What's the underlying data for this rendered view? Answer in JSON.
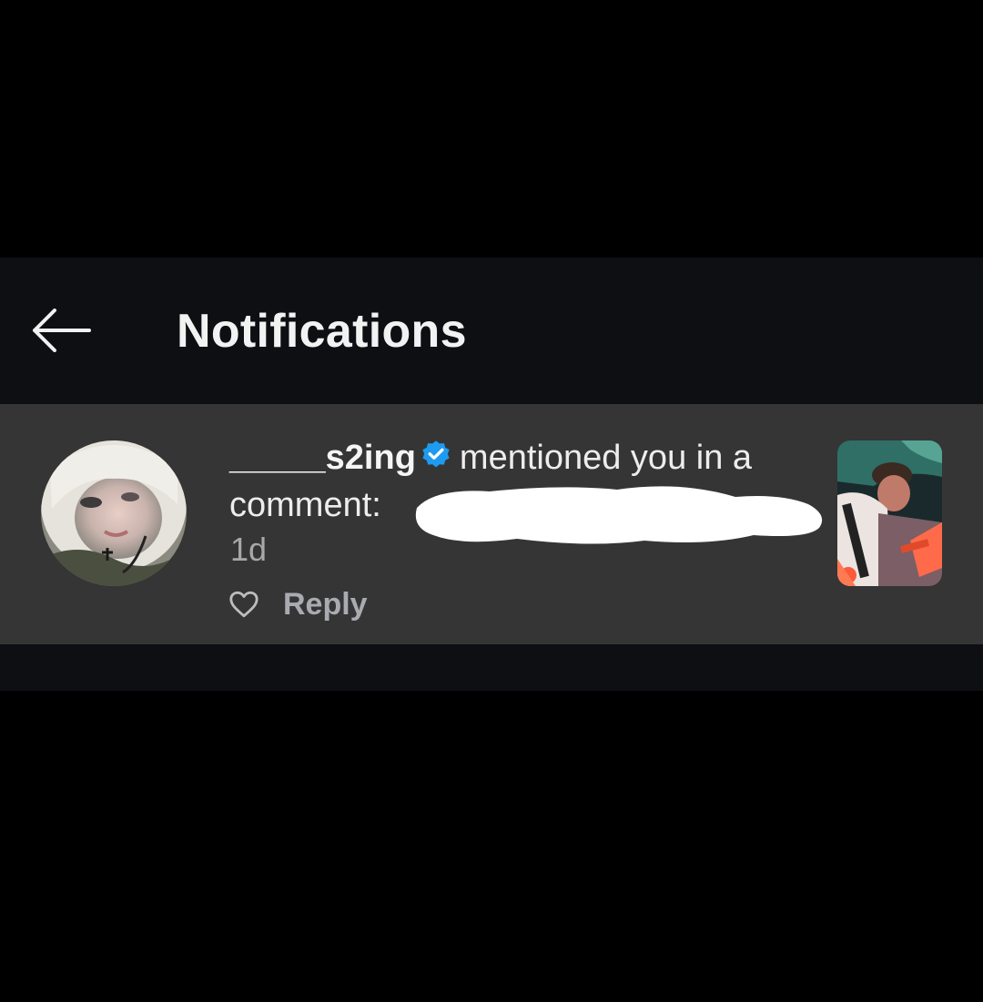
{
  "header": {
    "title": "Notifications",
    "back_icon": "arrow-left-icon"
  },
  "notification": {
    "username": "_____s2ing",
    "verified_icon": "verified-badge-icon",
    "verified_color": "#1d9bf0",
    "message": "mentioned you in a",
    "comment_prefix": "comment:",
    "timestamp": "1d",
    "like_icon": "heart-outline-icon",
    "reply_label": "Reply"
  },
  "colors": {
    "background": "#000000",
    "header_bg": "#0d0f13",
    "row_bg": "#353535",
    "text_primary": "#ededed",
    "text_secondary": "#a8a8a8"
  }
}
